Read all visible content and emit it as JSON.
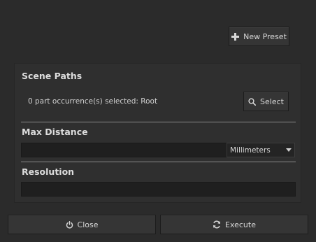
{
  "toolbar": {
    "new_preset_label": "New Preset"
  },
  "scene_paths": {
    "title": "Scene Paths",
    "selection_text": "0 part occurrence(s) selected: Root",
    "select_label": "Select"
  },
  "max_distance": {
    "title": "Max Distance",
    "value": "",
    "unit": "Millimeters"
  },
  "resolution": {
    "title": "Resolution",
    "value": ""
  },
  "footer": {
    "close_label": "Close",
    "execute_label": "Execute"
  },
  "icons": {
    "new_preset": "plus-icon",
    "select": "search-icon",
    "close": "power-icon",
    "execute": "refresh-icon",
    "unit_dropdown": "caret-down-icon"
  }
}
